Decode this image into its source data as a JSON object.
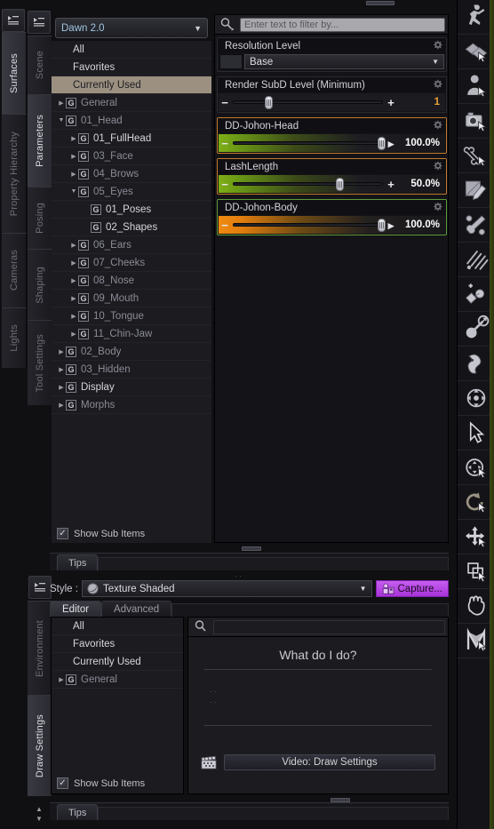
{
  "app": {
    "accent_orange": "#c27a2a",
    "accent_green": "#5e9b3a",
    "accent_purple": "#b845e0",
    "selection_tan": "#9c9081"
  },
  "left_tabs_outer": [
    {
      "label": "Surfaces",
      "active": true
    },
    {
      "label": "Property Hierarchy",
      "active": false
    },
    {
      "label": "Cameras",
      "active": false
    },
    {
      "label": "Lights",
      "active": false
    }
  ],
  "left_tabs_inner": [
    {
      "label": "Scene",
      "active": false
    },
    {
      "label": "Parameters",
      "active": true
    },
    {
      "label": "Posing",
      "active": false
    },
    {
      "label": "Shaping",
      "active": false
    },
    {
      "label": "Tool Settings",
      "active": false
    }
  ],
  "left_tabs_bottom": [
    {
      "label": "Environment",
      "active": false
    },
    {
      "label": "Draw Settings",
      "active": true
    }
  ],
  "parameters_pane": {
    "figure_selector": {
      "value": "Dawn 2.0",
      "caret": "▼"
    },
    "tree": [
      {
        "label": "All",
        "indent": 0,
        "arrow": "",
        "badge": false,
        "selected": false,
        "dim": false
      },
      {
        "label": "Favorites",
        "indent": 0,
        "arrow": "",
        "badge": false,
        "selected": false,
        "dim": false
      },
      {
        "label": "Currently Used",
        "indent": 0,
        "arrow": "",
        "badge": false,
        "selected": true,
        "dim": false
      },
      {
        "label": "General",
        "indent": 0,
        "arrow": "▶",
        "badge": true,
        "selected": false,
        "dim": true
      },
      {
        "label": "01_Head",
        "indent": 0,
        "arrow": "▼",
        "badge": true,
        "selected": false,
        "dim": true
      },
      {
        "label": "01_FullHead",
        "indent": 1,
        "arrow": "▶",
        "badge": true,
        "selected": false,
        "dim": false
      },
      {
        "label": "03_Face",
        "indent": 1,
        "arrow": "▶",
        "badge": true,
        "selected": false,
        "dim": true
      },
      {
        "label": "04_Brows",
        "indent": 1,
        "arrow": "▶",
        "badge": true,
        "selected": false,
        "dim": true
      },
      {
        "label": "05_Eyes",
        "indent": 1,
        "arrow": "▼",
        "badge": true,
        "selected": false,
        "dim": true
      },
      {
        "label": "01_Poses",
        "indent": 2,
        "arrow": "",
        "badge": true,
        "selected": false,
        "dim": false
      },
      {
        "label": "02_Shapes",
        "indent": 2,
        "arrow": "",
        "badge": true,
        "selected": false,
        "dim": false
      },
      {
        "label": "06_Ears",
        "indent": 1,
        "arrow": "▶",
        "badge": true,
        "selected": false,
        "dim": true
      },
      {
        "label": "07_Cheeks",
        "indent": 1,
        "arrow": "▶",
        "badge": true,
        "selected": false,
        "dim": true
      },
      {
        "label": "08_Nose",
        "indent": 1,
        "arrow": "▶",
        "badge": true,
        "selected": false,
        "dim": true
      },
      {
        "label": "09_Mouth",
        "indent": 1,
        "arrow": "▶",
        "badge": true,
        "selected": false,
        "dim": true
      },
      {
        "label": "10_Tongue",
        "indent": 1,
        "arrow": "▶",
        "badge": true,
        "selected": false,
        "dim": true
      },
      {
        "label": "11_Chin-Jaw",
        "indent": 1,
        "arrow": "▶",
        "badge": true,
        "selected": false,
        "dim": true
      },
      {
        "label": "02_Body",
        "indent": 0,
        "arrow": "▶",
        "badge": true,
        "selected": false,
        "dim": true
      },
      {
        "label": "03_Hidden",
        "indent": 0,
        "arrow": "▶",
        "badge": true,
        "selected": false,
        "dim": true
      },
      {
        "label": "Display",
        "indent": 0,
        "arrow": "▶",
        "badge": true,
        "selected": false,
        "dim": false
      },
      {
        "label": "Morphs",
        "indent": 0,
        "arrow": "▶",
        "badge": true,
        "selected": false,
        "dim": true
      }
    ],
    "show_sub_items": {
      "label": "Show Sub Items",
      "checked": true
    },
    "filter": {
      "placeholder": "Enter text to filter by...",
      "value": "",
      "icon": "search-icon"
    },
    "properties": [
      {
        "name": "Resolution Level",
        "kind": "combo",
        "value": "Base",
        "border": "none",
        "gear": "gear-icon",
        "caret": "▼"
      },
      {
        "name": "Render SubD Level (Minimum)",
        "kind": "slider",
        "value_text": "1",
        "value_amber": true,
        "fill_pct": 24,
        "gradient": "none",
        "border": "none",
        "gear": "gear-icon",
        "minus": "−",
        "plus": "+"
      },
      {
        "name": "DD-Johon-Head",
        "kind": "slider",
        "value_text": "100.0%",
        "value_amber": false,
        "fill_pct": 100,
        "gradient": "green",
        "border": "orange",
        "gear": "gear-icon",
        "minus": "−",
        "plus": "▸"
      },
      {
        "name": "LashLength",
        "kind": "slider",
        "value_text": "50.0%",
        "value_amber": false,
        "fill_pct": 72,
        "gradient": "green",
        "border": "orange",
        "gear": "gear-icon",
        "minus": "−",
        "plus": "+"
      },
      {
        "name": "DD-Johon-Body",
        "kind": "slider",
        "value_text": "100.0%",
        "value_amber": false,
        "fill_pct": 100,
        "gradient": "orange",
        "border": "green",
        "gear": "gear-icon",
        "minus": "−",
        "plus": "▸"
      }
    ]
  },
  "tips_top": {
    "tab_label": "Tips"
  },
  "draw_settings": {
    "style_label": "Style :",
    "style_value": "Texture Shaded",
    "style_caret": "▼",
    "capture_label": "Capture...",
    "tabs": [
      {
        "label": "Editor",
        "active": true
      },
      {
        "label": "Advanced",
        "active": false
      }
    ],
    "tree": [
      {
        "label": "All",
        "indent": 0,
        "arrow": "",
        "badge": false,
        "dim": false
      },
      {
        "label": "Favorites",
        "indent": 0,
        "arrow": "",
        "badge": false,
        "dim": false
      },
      {
        "label": "Currently Used",
        "indent": 0,
        "arrow": "",
        "badge": false,
        "dim": false
      },
      {
        "label": "General",
        "indent": 0,
        "arrow": "▶",
        "badge": true,
        "dim": true
      }
    ],
    "show_sub_items": {
      "label": "Show Sub Items",
      "checked": true
    },
    "help": {
      "search_placeholder": "",
      "title": "What do I do?",
      "video_button": "Video: Draw Settings",
      "video_icon": "film-clapper-icon"
    }
  },
  "tips_bottom": {
    "tab_label": "Tips"
  },
  "right_toolbar": [
    {
      "icon": "animate-figure-icon"
    },
    {
      "icon": "surface-selection-icon"
    },
    {
      "icon": "node-selection-icon"
    },
    {
      "icon": "camera-control-icon"
    },
    {
      "icon": "bone-tool-icon"
    },
    {
      "icon": "geometry-editor-icon"
    },
    {
      "icon": "node-weight-brush-icon"
    },
    {
      "icon": "mesh-grabber-icon"
    },
    {
      "icon": "joint-editor-icon"
    },
    {
      "icon": "spot-render-icon"
    },
    {
      "icon": "powerpose-icon"
    },
    {
      "icon": "universal-manipulator-icon"
    },
    {
      "icon": "pointer-icon"
    },
    {
      "icon": "active-pose-icon"
    },
    {
      "icon": "rotate-icon"
    },
    {
      "icon": "translate-icon"
    },
    {
      "icon": "scale-icon"
    },
    {
      "icon": "hand-pan-icon"
    },
    {
      "icon": "morph-tool-icon"
    }
  ]
}
